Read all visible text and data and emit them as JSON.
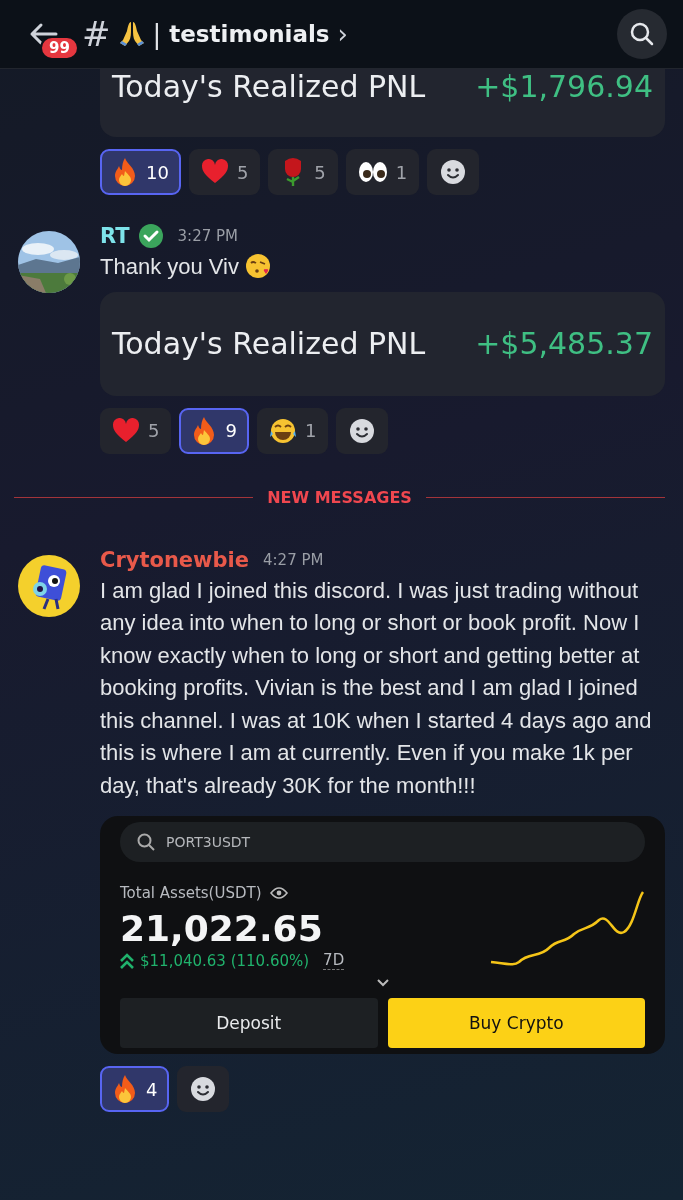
{
  "header": {
    "badge": "99",
    "hash": "#",
    "separator": "|",
    "channel": "testimonials",
    "chevron": "›"
  },
  "messages": [
    {
      "kind": "continued",
      "pnl": {
        "label": "Today's Realized PNL",
        "amount": "+$1,796.94"
      },
      "reactions": [
        {
          "kind": "fire",
          "count": "10",
          "selected": true
        },
        {
          "kind": "heart",
          "count": "5",
          "selected": false
        },
        {
          "kind": "rose",
          "count": "5",
          "selected": false
        },
        {
          "kind": "eyes",
          "count": "1",
          "selected": false
        }
      ]
    },
    {
      "kind": "pnl",
      "author": "RT",
      "color": "#7ee3ea",
      "verified": true,
      "time": "3:27 PM",
      "text": "Thank you Viv",
      "pnl": {
        "label": "Today's Realized PNL",
        "amount": "+$5,485.37"
      },
      "reactions": [
        {
          "kind": "heart",
          "count": "5",
          "selected": false
        },
        {
          "kind": "fire",
          "count": "9",
          "selected": true
        },
        {
          "kind": "laugh",
          "count": "1",
          "selected": false
        }
      ]
    },
    {
      "kind": "divider",
      "label": "NEW MESSAGES"
    },
    {
      "kind": "assets",
      "author": "Crytonewbie",
      "color": "#e8594a",
      "time": "4:27 PM",
      "text": "I am glad I joined this discord. I was just trading without any idea into when to long or short or book profit. Now I know exactly when to long or short and getting better at booking profits. Vivian is the best and I am glad I joined this channel. I was at 10K when I started 4 days ago and this is where I am at currently. Even if you make 1k per day, that's already 30K for the month!!!",
      "assets": {
        "search": "PORT3USDT",
        "label": "Total Assets(USDT)",
        "value": "21,022.65",
        "change": "$11,040.63 (110.60%)",
        "period": "7D",
        "buttons": [
          "Deposit",
          "Buy Crypto"
        ]
      },
      "reactions": [
        {
          "kind": "fire",
          "count": "4",
          "selected": true
        }
      ]
    }
  ]
}
